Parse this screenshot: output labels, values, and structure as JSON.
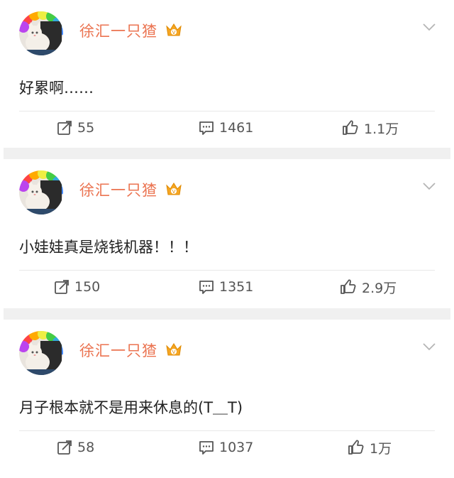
{
  "posts": [
    {
      "username": "徐汇一只猹",
      "text": "好累啊……",
      "reposts": "55",
      "comments": "1461",
      "likes": "1.1万"
    },
    {
      "username": "徐汇一只猹",
      "text": "小娃娃真是烧钱机器！！！",
      "reposts": "150",
      "comments": "1351",
      "likes": "2.9万"
    },
    {
      "username": "徐汇一只猹",
      "text": "月子根本就不是用来休息的(T＿T)",
      "reposts": "58",
      "comments": "1037",
      "likes": "1万"
    }
  ],
  "icons": {
    "badge": "crown-v-badge-icon",
    "menu": "chevron-down-icon",
    "repost": "repost-icon",
    "comment": "comment-icon",
    "like": "thumbs-up-icon"
  },
  "colors": {
    "username": "#eb7350",
    "badge": "#f5a623",
    "separator": "#f0f0f0"
  }
}
